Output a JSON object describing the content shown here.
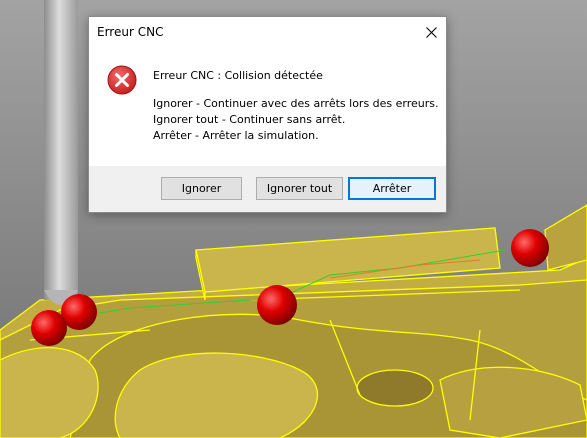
{
  "dialog": {
    "title": "Erreur CNC",
    "icon": "error-icon",
    "close": "close-icon",
    "message_main": "Erreur CNC : Collision détectée",
    "lines": [
      "Ignorer - Continuer avec des arrêts lors des erreurs.",
      "Ignorer tout - Continuer sans arrêt.",
      "Arrêter - Arrêter la simulation."
    ],
    "buttons": {
      "ignore": "Ignorer",
      "ignore_all": "Ignorer tout",
      "stop": "Arrêter"
    }
  },
  "colors": {
    "background_top": "#9a9a9a",
    "background_bottom": "#6e6e6e",
    "part_fill": "#c9b54b",
    "part_edges": "#ffff00",
    "collision_marker": "#e00000",
    "accent": "#0078d7"
  }
}
